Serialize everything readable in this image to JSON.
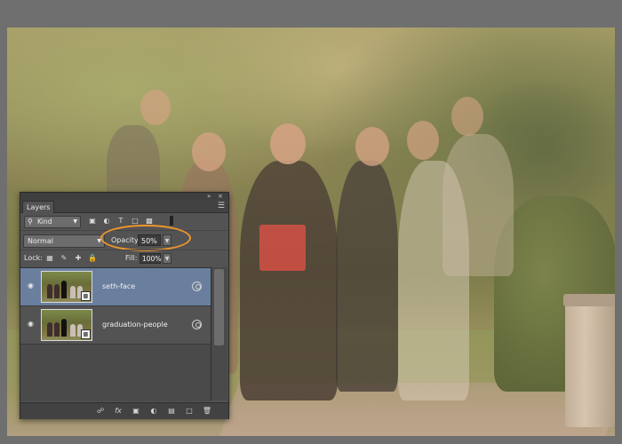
{
  "panel": {
    "title_tab": "Layers",
    "collapse_icon": "double-chevron",
    "close_icon": "close",
    "menu_icon": "panel-menu"
  },
  "filter": {
    "kind_label": "Kind",
    "icons": [
      "pixel-layer-filter",
      "adjustment-layer-filter",
      "type-layer-filter",
      "shape-layer-filter",
      "smart-object-filter"
    ]
  },
  "blend": {
    "mode": "Normal",
    "opacity_label": "Opacity:",
    "opacity_value": "50%",
    "highlight_color": "#f0962b"
  },
  "locks": {
    "label": "Lock:",
    "icons": [
      "lock-transparent-pixels",
      "lock-image-pixels",
      "lock-position",
      "lock-all"
    ],
    "fill_label": "Fill:",
    "fill_value": "100%"
  },
  "layers": [
    {
      "name": "seth-face",
      "selected": true
    },
    {
      "name": "graduation-people",
      "selected": false
    }
  ],
  "bottom_icons": [
    "link",
    "fx",
    "mask",
    "adjustment",
    "group",
    "new-layer",
    "trash"
  ],
  "colors": {
    "selected_layer": "#6a7f9e",
    "panel_bg": "#535353"
  }
}
